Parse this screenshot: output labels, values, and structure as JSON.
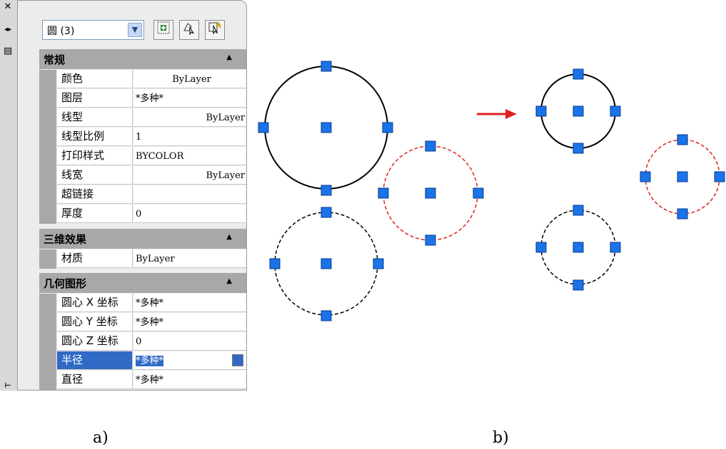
{
  "strip": {
    "close_glyph": "✕",
    "arrows_glyph": "◂▸",
    "props_glyph": "▤",
    "bottom_glyph": "⊢"
  },
  "selector": {
    "value": "圆 (3)",
    "dropdown_glyph": "▼"
  },
  "toolbar": {
    "pickadd_icon": "toggle-pickadd-icon",
    "select_icon": "select-objects-icon",
    "quickselect_icon": "quick-select-icon"
  },
  "sections": [
    {
      "title": "常规",
      "collapse_glyph": "▲",
      "rows": [
        {
          "name": "颜色",
          "value": "ByLayer",
          "align": "ctr"
        },
        {
          "name": "图层",
          "value": "*多种*",
          "align": ""
        },
        {
          "name": "线型",
          "value": "ByLayer",
          "align": "rt"
        },
        {
          "name": "线型比例",
          "value": "1",
          "align": ""
        },
        {
          "name": "打印样式",
          "value": "BYCOLOR",
          "align": ""
        },
        {
          "name": "线宽",
          "value": "ByLayer",
          "align": "rt"
        },
        {
          "name": "超链接",
          "value": "",
          "align": ""
        },
        {
          "name": "厚度",
          "value": "0",
          "align": ""
        }
      ]
    },
    {
      "title": "三维效果",
      "collapse_glyph": "▲",
      "rows": [
        {
          "name": "材质",
          "value": "ByLayer",
          "align": ""
        }
      ]
    },
    {
      "title": "几何图形",
      "collapse_glyph": "▲",
      "rows": [
        {
          "name": "圆心 X 坐标",
          "value": "*多种*",
          "align": ""
        },
        {
          "name": "圆心 Y 坐标",
          "value": "*多种*",
          "align": ""
        },
        {
          "name": "圆心 Z 坐标",
          "value": "0",
          "align": ""
        },
        {
          "name": "半径",
          "value": "*多种*",
          "align": "",
          "active": true
        },
        {
          "name": "直径",
          "value": "*多种*",
          "align": ""
        }
      ]
    }
  ],
  "captions": {
    "a": "a)",
    "b": "b)"
  },
  "colors": {
    "grip": "#1a73e8",
    "red_circle": "#e02020",
    "arrow": "#e02020",
    "selection": "#316ac5"
  }
}
